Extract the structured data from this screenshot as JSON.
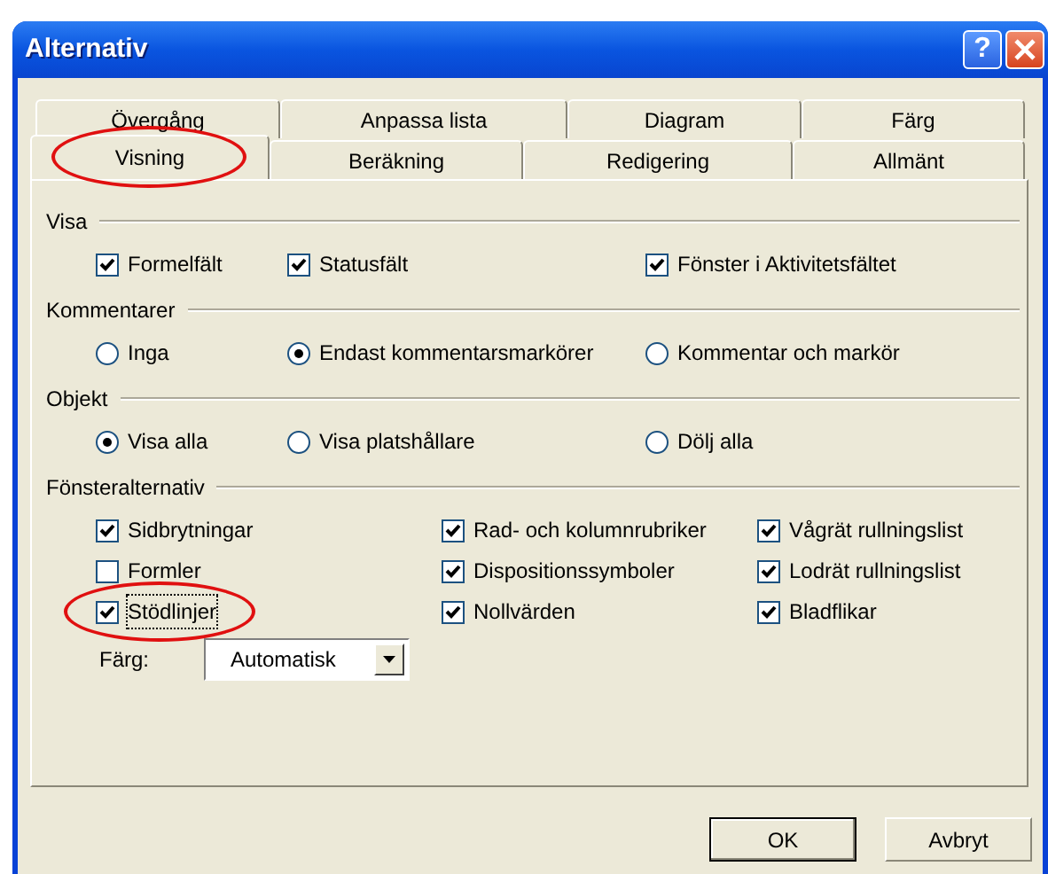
{
  "window": {
    "title": "Alternativ",
    "help_button": "?"
  },
  "tab_rows": [
    {
      "tabs": [
        {
          "label": "Övergång",
          "selected": false,
          "circled": false
        },
        {
          "label": "Anpassa lista",
          "selected": false,
          "circled": false
        },
        {
          "label": "Diagram",
          "selected": false,
          "circled": false
        },
        {
          "label": "Färg",
          "selected": false,
          "circled": false
        }
      ]
    },
    {
      "tabs": [
        {
          "label": "Visning",
          "selected": true,
          "circled": true
        },
        {
          "label": "Beräkning",
          "selected": false,
          "circled": false
        },
        {
          "label": "Redigering",
          "selected": false,
          "circled": false
        },
        {
          "label": "Allmänt",
          "selected": false,
          "circled": false
        }
      ]
    }
  ],
  "sections": [
    {
      "title": "Visa",
      "items": [
        {
          "kind": "checkbox",
          "label": "Formelfält",
          "checked": true,
          "circled": false
        },
        {
          "kind": "checkbox",
          "label": "Statusfält",
          "checked": true,
          "circled": false
        },
        {
          "kind": "checkbox",
          "label": "Fönster i Aktivitetsfältet",
          "checked": true,
          "circled": false
        }
      ]
    },
    {
      "title": "Kommentarer",
      "items": [
        {
          "kind": "radio",
          "label": "Inga",
          "selected": false,
          "circled": false
        },
        {
          "kind": "radio",
          "label": "Endast kommentarsmarkörer",
          "selected": true,
          "circled": false
        },
        {
          "kind": "radio",
          "label": "Kommentar och markör",
          "selected": false,
          "circled": false
        }
      ]
    },
    {
      "title": "Objekt",
      "items": [
        {
          "kind": "radio",
          "label": "Visa alla",
          "selected": true,
          "circled": false
        },
        {
          "kind": "radio",
          "label": "Visa platshållare",
          "selected": false,
          "circled": false
        },
        {
          "kind": "radio",
          "label": "Dölj alla",
          "selected": false,
          "circled": false
        }
      ]
    },
    {
      "title": "Fönsteralternativ",
      "items": [
        {
          "kind": "checkbox",
          "label": "Sidbrytningar",
          "checked": true,
          "circled": false
        },
        {
          "kind": "checkbox",
          "label": "Rad- och kolumnrubriker",
          "checked": true,
          "circled": false
        },
        {
          "kind": "checkbox",
          "label": "Vågrät rullningslist",
          "checked": true,
          "circled": false
        },
        {
          "kind": "checkbox",
          "label": "Formler",
          "checked": false,
          "circled": false
        },
        {
          "kind": "checkbox",
          "label": "Dispositionssymboler",
          "checked": true,
          "circled": false
        },
        {
          "kind": "checkbox",
          "label": "Lodrät rullningslist",
          "checked": true,
          "circled": false
        },
        {
          "kind": "checkbox",
          "label": "Stödlinjer",
          "checked": true,
          "circled": true
        },
        {
          "kind": "checkbox",
          "label": "Nollvärden",
          "checked": true,
          "circled": false
        },
        {
          "kind": "checkbox",
          "label": "Bladflikar",
          "checked": true,
          "circled": false
        }
      ],
      "color_field": {
        "label": "Färg:",
        "value": "Automatisk"
      }
    }
  ],
  "buttons": [
    "OK",
    "Avbryt"
  ]
}
